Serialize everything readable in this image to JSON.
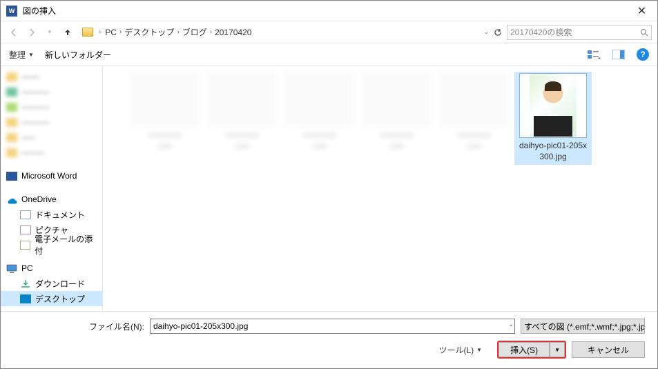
{
  "title": "図の挿入",
  "breadcrumb": {
    "root": "PC",
    "a": "デスクトップ",
    "b": "ブログ",
    "c": "20170420"
  },
  "search_placeholder": "20170420の検索",
  "toolbar": {
    "organize": "整理",
    "newfolder": "新しいフォルダー"
  },
  "sidebar": {
    "word": "Microsoft Word",
    "onedrive": "OneDrive",
    "documents": "ドキュメント",
    "pictures": "ピクチャ",
    "mail": "電子メールの添付",
    "pc": "PC",
    "downloads": "ダウンロード",
    "desktop": "デスクトップ"
  },
  "selected_file": {
    "name": "daihyo-pic01-205x300.jpg"
  },
  "filename_label": "ファイル名(N):",
  "filename_value": "daihyo-pic01-205x300.jpg",
  "filter_label": "すべての図 (*.emf;*.wmf;*.jpg;*.jp",
  "tools_label": "ツール(L)",
  "insert_label": "挿入(S)",
  "cancel_label": "キャンセル"
}
